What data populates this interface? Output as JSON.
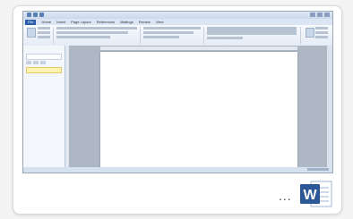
{
  "thumbnail": {
    "app": "Microsoft Word 2010",
    "menu_tabs": [
      "File",
      "Home",
      "Insert",
      "Page Layout",
      "References",
      "Mailings",
      "Review",
      "View"
    ],
    "accent": "#2a5caa",
    "highlight": "#fff3b0"
  },
  "footer": {
    "ellipsis": "...",
    "icon_letter": "W",
    "icon_color": "#2b5797"
  }
}
